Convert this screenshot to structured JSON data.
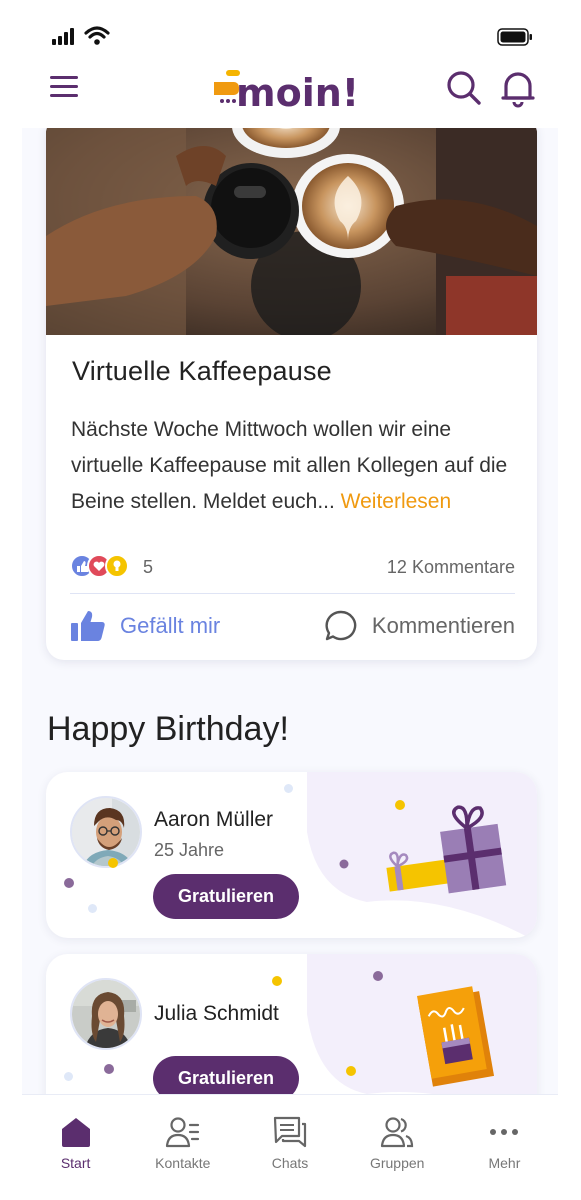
{
  "app": {
    "brand": "moin!",
    "colors": {
      "primary": "#5b2e6e",
      "accent": "#f09a10",
      "like": "#6a83e0",
      "background": "#f8f9fe"
    }
  },
  "status_bar": {
    "icons": [
      "signal-icon",
      "wifi-icon",
      "battery-icon"
    ]
  },
  "header": {
    "icons": [
      "menu-icon",
      "search-icon",
      "bell-icon"
    ]
  },
  "post": {
    "title": "Virtuelle Kaffeepause",
    "text": "Nächste Woche Mittwoch wollen wir eine virtuelle Kaffeepause mit allen Kollegen auf die Beine stellen. Meldet euch...",
    "read_more": "Weiterlesen",
    "reaction_count": "5",
    "comment_count": "12 Kommentare",
    "like_label": "Gefällt mir",
    "comment_label": "Kommentieren"
  },
  "birthday": {
    "title": "Happy Birthday!",
    "people": [
      {
        "name": "Aaron Müller",
        "age": "25 Jahre",
        "button": "Gratulieren"
      },
      {
        "name": "Julia Schmidt",
        "age": "",
        "button": "Gratulieren"
      }
    ]
  },
  "tabbar": {
    "items": [
      {
        "label": "Start",
        "icon": "home-icon",
        "active": true
      },
      {
        "label": "Kontakte",
        "icon": "contacts-icon",
        "active": false
      },
      {
        "label": "Chats",
        "icon": "chats-icon",
        "active": false
      },
      {
        "label": "Gruppen",
        "icon": "groups-icon",
        "active": false
      },
      {
        "label": "Mehr",
        "icon": "more-icon",
        "active": false
      }
    ]
  }
}
